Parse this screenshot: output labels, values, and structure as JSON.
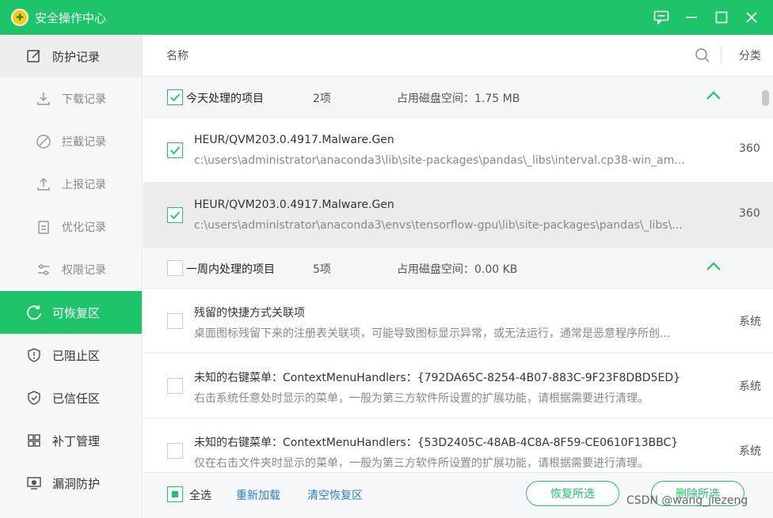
{
  "window": {
    "title": "安全操作中心",
    "logo_glyph": "360"
  },
  "sidebar": {
    "items": [
      {
        "label": "防护记录",
        "icon": "edit-record-icon"
      },
      {
        "label": "下载记录",
        "icon": "download-icon"
      },
      {
        "label": "拦截记录",
        "icon": "block-icon"
      },
      {
        "label": "上报记录",
        "icon": "upload-icon"
      },
      {
        "label": "优化记录",
        "icon": "clipboard-icon"
      },
      {
        "label": "权限记录",
        "icon": "sliders-icon"
      },
      {
        "label": "可恢复区",
        "icon": "restore-icon"
      },
      {
        "label": "已阻止区",
        "icon": "shield-alert-icon"
      },
      {
        "label": "已信任区",
        "icon": "shield-check-icon"
      },
      {
        "label": "补丁管理",
        "icon": "grid-icon"
      },
      {
        "label": "漏洞防护",
        "icon": "monitor-shield-icon"
      }
    ]
  },
  "header": {
    "col_name": "名称",
    "col_category": "分类"
  },
  "groups": [
    {
      "name": "今天处理的项目",
      "count": "2项",
      "disk": "占用磁盘空间：1.75 MB",
      "rows": [
        {
          "title": "HEUR/QVM203.0.4917.Malware.Gen",
          "path": "c:\\users\\administrator\\anaconda3\\lib\\site-packages\\pandas\\_libs\\interval.cp38-win_am...",
          "category": "360"
        },
        {
          "title": "HEUR/QVM203.0.4917.Malware.Gen",
          "path": "c:\\users\\administrator\\anaconda3\\envs\\tensorflow-gpu\\lib\\site-packages\\pandas\\_libs\\...",
          "category": "360"
        }
      ]
    },
    {
      "name": "一周内处理的项目",
      "count": "5项",
      "disk": "占用磁盘空间：0.00 KB",
      "rows": [
        {
          "title": "残留的快捷方式关联项",
          "path": "桌面图标残留下来的注册表关联项，可能导致图标显示异常，或无法运行，通常是恶意程序所创...",
          "category": "系统"
        },
        {
          "title": "未知的右键菜单：ContextMenuHandlers：{792DA65C-8254-4B07-883C-9F23F8DBD5ED}",
          "path": "右击系统任意处时显示的菜单，一般为第三方软件所设置的扩展功能，请根据需要进行清理。",
          "category": "系统"
        },
        {
          "title": "未知的右键菜单：ContextMenuHandlers：{53D2405C-48AB-4C8A-8F59-CE0610F13BBC}",
          "path": "仅在右击文件夹时显示的菜单，一般为第三方软件所设置的扩展功能，请根据需要进行清理。",
          "category": "系统"
        }
      ]
    }
  ],
  "footer": {
    "select_all": "全选",
    "reload": "重新加载",
    "clear": "清空恢复区",
    "restore_btn": "恢复所选",
    "delete_btn": "删除所选",
    "watermark": "CSDN @wang_jiezeng"
  },
  "colors": {
    "accent": "#1ec46a",
    "link": "#2a7fd4"
  }
}
